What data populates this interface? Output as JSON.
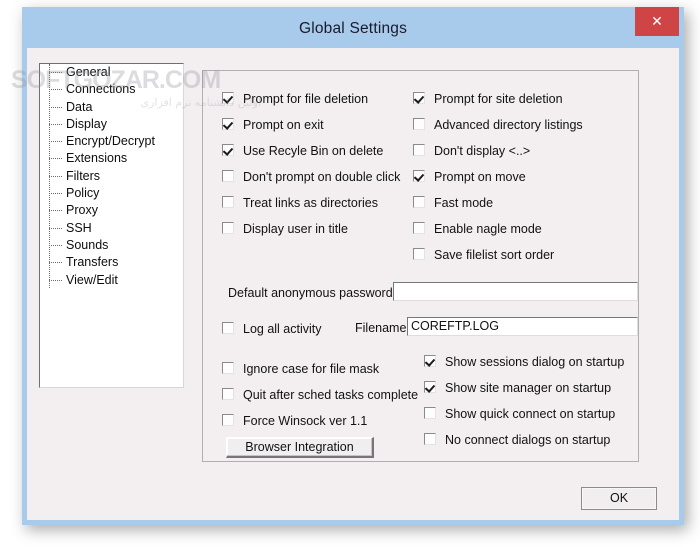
{
  "window": {
    "title": "Global Settings",
    "close_label": "✕",
    "close_icon": "close-icon"
  },
  "watermark": {
    "main": "SOFTGOZAR.COM",
    "sub": "اولین دانشنامه نرم افزاری"
  },
  "sidebar": {
    "items": [
      {
        "label": "General"
      },
      {
        "label": "Connections"
      },
      {
        "label": "Data"
      },
      {
        "label": "Display"
      },
      {
        "label": "Encrypt/Decrypt"
      },
      {
        "label": "Extensions"
      },
      {
        "label": "Filters"
      },
      {
        "label": "Policy"
      },
      {
        "label": "Proxy"
      },
      {
        "label": "SSH"
      },
      {
        "label": "Sounds"
      },
      {
        "label": "Transfers"
      },
      {
        "label": "View/Edit"
      }
    ]
  },
  "options": {
    "left_column": [
      {
        "label": "Prompt for file deletion",
        "checked": true
      },
      {
        "label": "Prompt on exit",
        "checked": true
      },
      {
        "label": "Use Recyle Bin on delete",
        "checked": true
      },
      {
        "label": "Don't prompt on double click",
        "checked": false
      },
      {
        "label": "Treat links as directories",
        "checked": false
      },
      {
        "label": "Display user in title",
        "checked": false
      }
    ],
    "right_column": [
      {
        "label": "Prompt for site deletion",
        "checked": true
      },
      {
        "label": "Advanced directory listings",
        "checked": false
      },
      {
        "label": "Don't display <..>",
        "checked": false
      },
      {
        "label": "Prompt on move",
        "checked": true
      },
      {
        "label": "Fast mode",
        "checked": false
      },
      {
        "label": "Enable nagle mode",
        "checked": false
      },
      {
        "label": "Save filelist sort order",
        "checked": false
      }
    ],
    "bottom_left": [
      {
        "label": "Ignore case for file mask",
        "checked": false
      },
      {
        "label": "Quit after sched tasks complete",
        "checked": false
      },
      {
        "label": "Force Winsock ver 1.1",
        "checked": false
      }
    ],
    "bottom_right": [
      {
        "label": "Show sessions dialog on startup",
        "checked": true
      },
      {
        "label": "Show site manager on startup",
        "checked": true
      },
      {
        "label": "Show quick connect on startup",
        "checked": false
      },
      {
        "label": "No connect dialogs on startup",
        "checked": false
      }
    ]
  },
  "fields": {
    "anon_password_label": "Default anonymous password:",
    "anon_password_value": "",
    "log_all_activity_label": "Log all activity",
    "log_all_activity_checked": false,
    "filename_label": "Filename:",
    "filename_value": "COREFTP.LOG"
  },
  "buttons": {
    "browser_integration": "Browser Integration",
    "ok": "OK"
  },
  "colors": {
    "titlebar": "#a8cbec",
    "close_button": "#cf4545",
    "dialog_background": "#f3eff1"
  }
}
